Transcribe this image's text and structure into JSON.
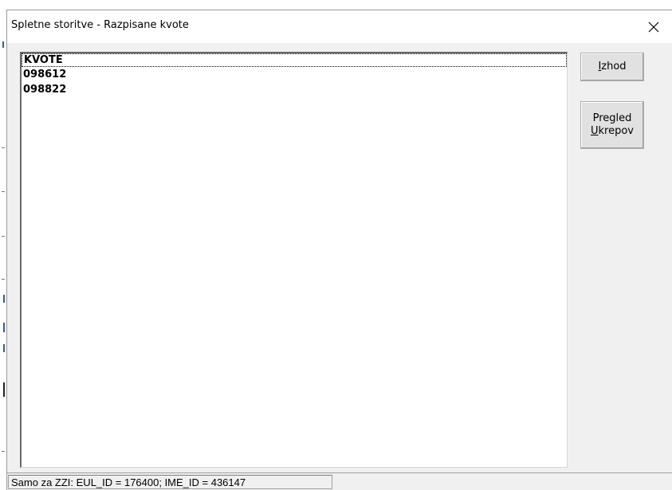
{
  "window": {
    "title": "Spletne storitve - Razpisane kvote"
  },
  "list": {
    "items": [
      "KVOTE",
      "098612",
      "098822"
    ],
    "selected_index": 0
  },
  "buttons": {
    "izhod": {
      "accel": "I",
      "rest": "zhod"
    },
    "pregled": {
      "line1": "Pregled",
      "accel": "U",
      "rest": "krepov"
    }
  },
  "statusbar": {
    "text": "Samo za ZZI: EUL_ID = 176400; IME_ID = 436147"
  },
  "icons": {
    "close": "close-icon"
  },
  "colors": {
    "window_bg": "#f0f0f0",
    "titlebar_bg": "#ffffff",
    "list_bg": "#ffffff",
    "button_bg": "#e1e1e1"
  }
}
